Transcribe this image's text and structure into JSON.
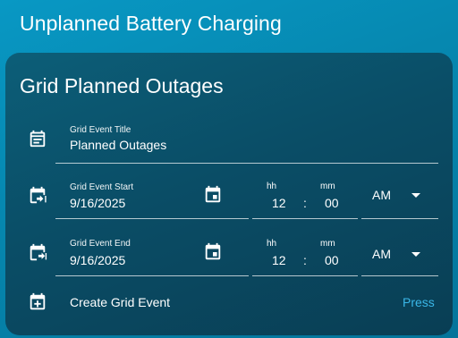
{
  "page": {
    "title": "Unplanned Battery Charging"
  },
  "card": {
    "title": "Grid Planned Outages",
    "event_title": {
      "label": "Grid Event Title",
      "value": "Planned Outages",
      "icon": "calendar-text-icon"
    },
    "event_start": {
      "label": "Grid Event Start",
      "date": "9/16/2025",
      "icon": "calendar-start-icon",
      "picker_icon": "calendar-picker-icon",
      "hh_label": "hh",
      "mm_label": "mm",
      "hour": "12",
      "separator": ":",
      "minute": "00",
      "ampm": "AM"
    },
    "event_end": {
      "label": "Grid Event End",
      "date": "9/16/2025",
      "icon": "calendar-end-icon",
      "picker_icon": "calendar-picker-icon",
      "hh_label": "hh",
      "mm_label": "mm",
      "hour": "12",
      "separator": ":",
      "minute": "00",
      "ampm": "AM"
    },
    "create": {
      "label": "Create Grid Event",
      "action": "Press",
      "icon": "calendar-plus-icon"
    }
  },
  "colors": {
    "background": "#0898c4",
    "card": "#0a4d66",
    "accent": "#3ab7e8",
    "text": "#ffffff"
  }
}
